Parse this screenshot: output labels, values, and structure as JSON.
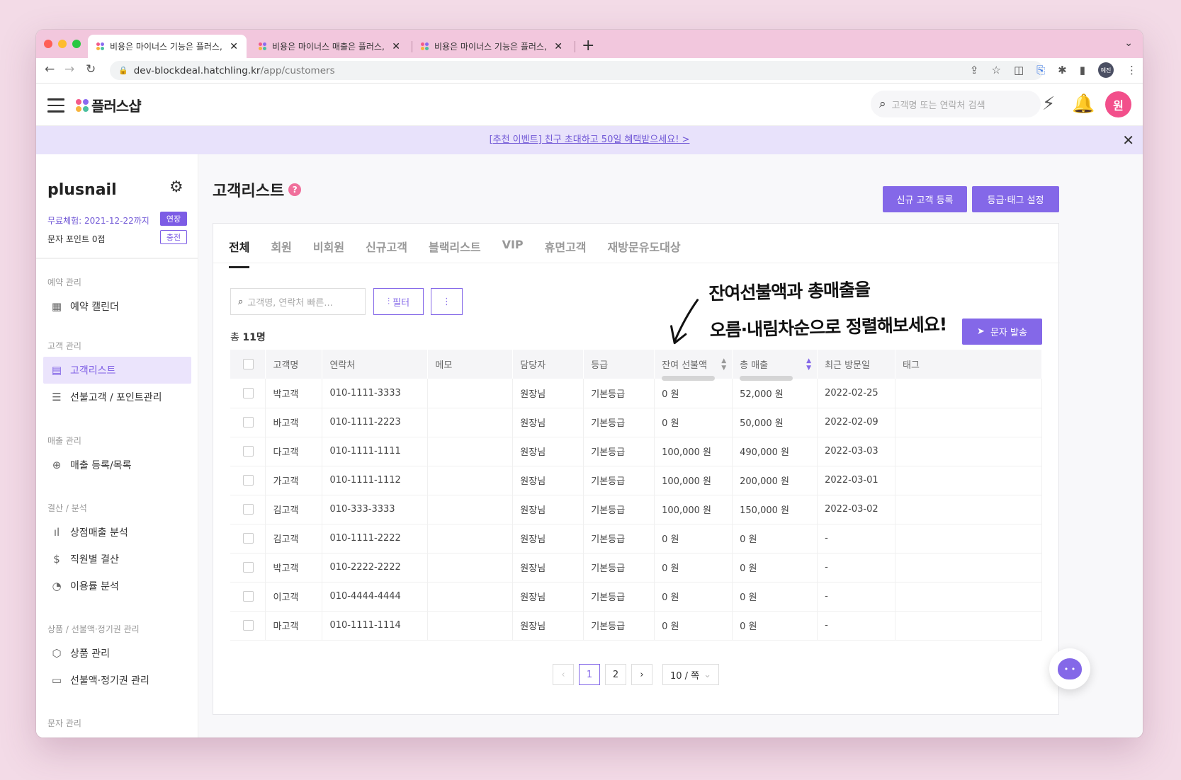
{
  "browser": {
    "tabs": [
      {
        "label": "비용은 마이너스 기능은 플러스, 플러스"
      },
      {
        "label": "비용은 마이너스 매출은 플러스, 플러스"
      },
      {
        "label": "비용은 마이너스 기능은 플러스, 플러스"
      }
    ],
    "url_host": "dev-blockdeal.hatchling.kr",
    "url_path": "/app/customers",
    "profile_label": "예진"
  },
  "header": {
    "logo_text": "플러스샵",
    "search_placeholder": "고객명 또는 연락처 검색",
    "avatar_label": "원"
  },
  "banner": {
    "text": "[추천 이벤트] 친구 초대하고 50일 혜택받으세요! >"
  },
  "sidebar": {
    "shop_name": "plusnail",
    "trial_text": "무료체험: 2021-12-22까지",
    "extend_label": "연장",
    "points_text": "문자 포인트 0점",
    "charge_label": "충전",
    "sections": [
      {
        "title": "예약 관리",
        "items": [
          {
            "label": "예약 캘린더",
            "icon": "calendar-icon"
          }
        ]
      },
      {
        "title": "고객 관리",
        "items": [
          {
            "label": "고객리스트",
            "icon": "document-icon"
          },
          {
            "label": "선불고객 / 포인트관리",
            "icon": "database-icon"
          }
        ]
      },
      {
        "title": "매출 관리",
        "items": [
          {
            "label": "매출 등록/목록",
            "icon": "file-add-icon"
          }
        ]
      },
      {
        "title": "결산 / 분석",
        "items": [
          {
            "label": "상점매출 분석",
            "icon": "bar-chart-icon"
          },
          {
            "label": "직원별 결산",
            "icon": "dollar-icon"
          },
          {
            "label": "이용률 분석",
            "icon": "pie-chart-icon"
          }
        ]
      },
      {
        "title": "상품 / 선불액·정기권 관리",
        "items": [
          {
            "label": "상품 관리",
            "icon": "box-icon"
          },
          {
            "label": "선불액·정기권 관리",
            "icon": "ticket-icon"
          }
        ]
      },
      {
        "title": "문자 관리",
        "items": []
      }
    ]
  },
  "main": {
    "title": "고객리스트",
    "new_customer_button": "신규 고객 등록",
    "grade_tag_button": "등급·태그 설정",
    "tabs": [
      "전체",
      "회원",
      "비회원",
      "신규고객",
      "블랙리스트",
      "VIP",
      "휴면고객",
      "재방문유도대상"
    ],
    "search_placeholder": "고객명, 연락처 빠른...",
    "filter_label": "필터",
    "total_prefix": "총",
    "total_count": "11명",
    "sms_button": "문자 발송",
    "annotation_line1": "잔여선불액과 총매출을",
    "annotation_line2": "오름·내림차순으로 정렬해보세요!",
    "columns": [
      "고객명",
      "연락처",
      "메모",
      "담당자",
      "등급",
      "잔여 선불액",
      "총 매출",
      "최근 방문일",
      "태그"
    ],
    "rows": [
      {
        "name": "박고객",
        "phone": "010-1111-3333",
        "memo": "",
        "staff": "원장님",
        "grade": "기본등급",
        "prepaid": "0 원",
        "sales": "52,000 원",
        "last_visit": "2022-02-25",
        "tag": ""
      },
      {
        "name": "바고객",
        "phone": "010-1111-2223",
        "memo": "",
        "staff": "원장님",
        "grade": "기본등급",
        "prepaid": "0 원",
        "sales": "50,000 원",
        "last_visit": "2022-02-09",
        "tag": ""
      },
      {
        "name": "다고객",
        "phone": "010-1111-1111",
        "memo": "",
        "staff": "원장님",
        "grade": "기본등급",
        "prepaid": "100,000 원",
        "sales": "490,000 원",
        "last_visit": "2022-03-03",
        "tag": ""
      },
      {
        "name": "가고객",
        "phone": "010-1111-1112",
        "memo": "",
        "staff": "원장님",
        "grade": "기본등급",
        "prepaid": "100,000 원",
        "sales": "200,000 원",
        "last_visit": "2022-03-01",
        "tag": ""
      },
      {
        "name": "김고객",
        "phone": "010-333-3333",
        "memo": "",
        "staff": "원장님",
        "grade": "기본등급",
        "prepaid": "100,000 원",
        "sales": "150,000 원",
        "last_visit": "2022-03-02",
        "tag": ""
      },
      {
        "name": "김고객",
        "phone": "010-1111-2222",
        "memo": "",
        "staff": "원장님",
        "grade": "기본등급",
        "prepaid": "0 원",
        "sales": "0 원",
        "last_visit": "-",
        "tag": ""
      },
      {
        "name": "박고객",
        "phone": "010-2222-2222",
        "memo": "",
        "staff": "원장님",
        "grade": "기본등급",
        "prepaid": "0 원",
        "sales": "0 원",
        "last_visit": "-",
        "tag": ""
      },
      {
        "name": "이고객",
        "phone": "010-4444-4444",
        "memo": "",
        "staff": "원장님",
        "grade": "기본등급",
        "prepaid": "0 원",
        "sales": "0 원",
        "last_visit": "-",
        "tag": ""
      },
      {
        "name": "마고객",
        "phone": "010-1111-1114",
        "memo": "",
        "staff": "원장님",
        "grade": "기본등급",
        "prepaid": "0 원",
        "sales": "0 원",
        "last_visit": "-",
        "tag": ""
      }
    ],
    "pagination": {
      "pages": [
        "1",
        "2"
      ],
      "current": "1",
      "page_size": "10 / 쪽"
    }
  },
  "colors": {
    "accent": "#8468e8",
    "banner_bg": "#e8e2fb",
    "avatar": "#f24f8b",
    "tabstrip": "#f2c7dd"
  }
}
